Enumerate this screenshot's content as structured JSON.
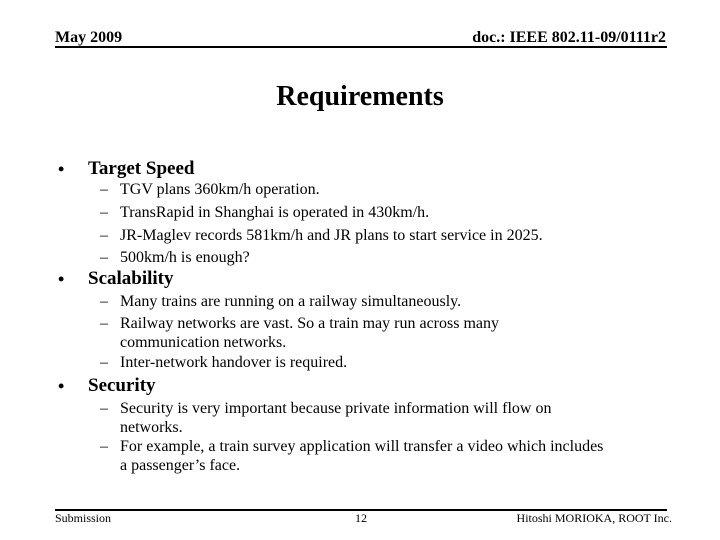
{
  "header": {
    "date": "May 2009",
    "doc_id": "doc.: IEEE 802.11-09/0111r2"
  },
  "title": "Requirements",
  "sections": [
    {
      "bullet": "•",
      "label": "Target Speed",
      "items": [
        "TGV plans 360km/h operation.",
        "TransRapid in Shanghai is operated in 430km/h.",
        "JR-Maglev records 581km/h and JR plans to start service in 2025.",
        "500km/h is enough?"
      ]
    },
    {
      "bullet": "•",
      "label": "Scalability",
      "items": [
        "Many trains are running on a railway simultaneously.",
        "Railway networks are vast. So a train may run across many communication networks.",
        "Inter-network handover is required."
      ]
    },
    {
      "bullet": "•",
      "label": "Security",
      "items": [
        "Security is very important because private information will flow on networks.",
        "For example, a train survey application will transfer a video which includes a passenger’s face."
      ]
    }
  ],
  "dash": "–",
  "footer": {
    "left": "Submission",
    "page_number": "12",
    "author": "Hitoshi MORIOKA, ROOT Inc."
  }
}
